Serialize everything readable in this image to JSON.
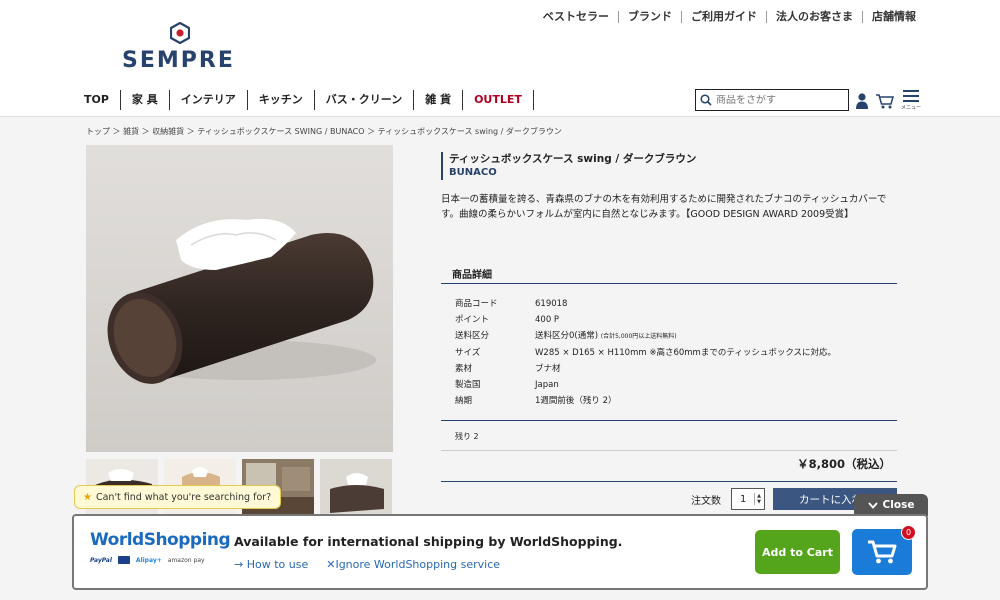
{
  "header": {
    "top_links": [
      "ベストセラー",
      "ブランド",
      "ご利用ガイド",
      "法人のお客さま",
      "店舗情報"
    ],
    "logo_text": "SEMPRE",
    "nav": [
      "TOP",
      "家 具",
      "インテリア",
      "キッチン",
      "バス・クリーン",
      "雑 貨",
      "OUTLET"
    ],
    "search_placeholder": "商品をさがす",
    "menu_label": "メニュー"
  },
  "breadcrumb": "トップ ＞ 雑貨 ＞ 収納雑貨 ＞ ティッシュボックスケース SWING / BUNACO ＞ ティッシュボックスケース swing / ダークブラウン",
  "product": {
    "title": "ティッシュボックスケース swing / ダークブラウン",
    "brand": "BUNACO",
    "description": "日本一の蓄積量を誇る、青森県のブナの木を有効利用するために開発されたブナコのティッシュカバーです。曲線の柔らかいフォルムが室内に自然となじみます。【GOOD DESIGN AWARD 2009受賞】",
    "details_heading": "商品詳細",
    "specs": [
      {
        "label": "商品コード",
        "value": "619018",
        "note": ""
      },
      {
        "label": "ポイント",
        "value": "400 P",
        "note": ""
      },
      {
        "label": "送料区分",
        "value": "送料区分0(通常)",
        "note": "(合計5,000円以上送料無料)"
      },
      {
        "label": "サイズ",
        "value": "W285 × D165 × H110mm ※高さ60mmまでのティッシュボックスに対応。",
        "note": ""
      },
      {
        "label": "素材",
        "value": "ブナ材",
        "note": ""
      },
      {
        "label": "製造国",
        "value": "Japan",
        "note": ""
      },
      {
        "label": "納期",
        "value": "1週間前後（残り 2）",
        "note": ""
      }
    ],
    "stock": "残り 2",
    "price": "￥8,800（税込）",
    "qty_label": "注文数",
    "qty": "1",
    "cart_button": "カートに入れ"
  },
  "worldshopping": {
    "tooltip": "Can't find what you're searching for?",
    "close": "Close",
    "logo": "WorldShopping",
    "payments": [
      "PayPal",
      "Alipay+",
      "amazon pay"
    ],
    "message": "Available for international shipping by WorldShopping.",
    "how_to_use": "How to use",
    "ignore": "Ignore WorldShopping service",
    "add_to_cart": "Add to Cart",
    "cart_count": "0"
  },
  "colors": {
    "brand_navy": "#27426d",
    "outlet_red": "#b00020",
    "cart_button": "#3b5781",
    "ws_green": "#55a51c",
    "ws_blue": "#1a7bd8"
  }
}
